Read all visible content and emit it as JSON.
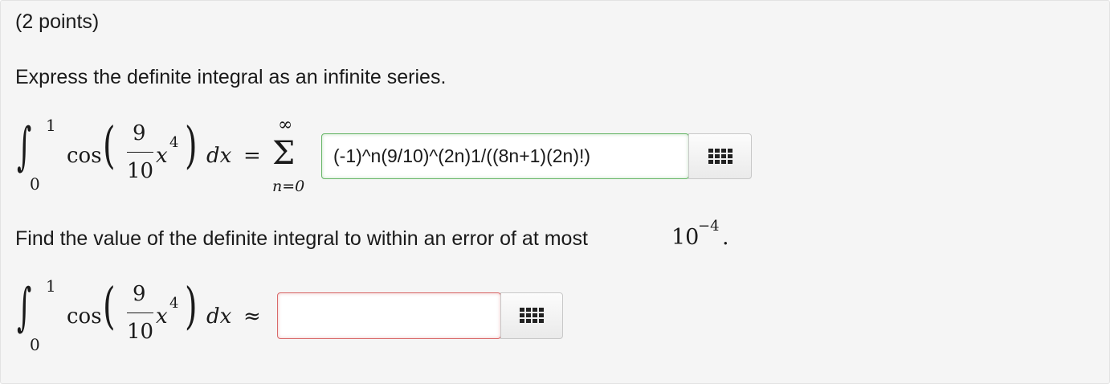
{
  "problem": {
    "points": "(2 points)",
    "prompt1": "Express the definite integral as an infinite series.",
    "prompt2": "Find the value of the definite integral to within an error of at most ",
    "error_base": "10",
    "error_exp": "−4",
    "error_end": "."
  },
  "integral": {
    "upper": "1",
    "lower": "0",
    "func": "cos",
    "numerator": "9",
    "denominator": "10",
    "var": "x",
    "power": "4",
    "dx": "dx"
  },
  "series": {
    "equals": "=",
    "sigma": "Σ",
    "upper": "∞",
    "lower": "n=0"
  },
  "approx_symbol": "≈",
  "answers": {
    "series_answer": "(-1)^n(9/10)^(2n)1/((8n+1)(2n)!)",
    "series_status": "correct",
    "value_answer": "",
    "value_status": "incorrect"
  },
  "icons": {
    "palette": "equation-palette-icon"
  },
  "colors": {
    "correct_border": "#67b667",
    "incorrect_border": "#d96a6a",
    "panel_background": "#f5f5f5"
  }
}
